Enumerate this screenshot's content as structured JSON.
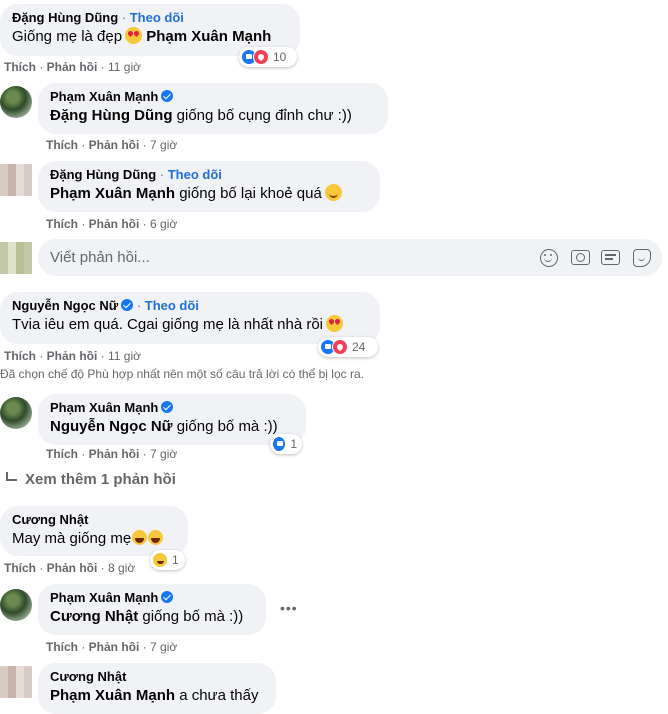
{
  "actions": {
    "like": "Thích",
    "reply": "Phản hồi"
  },
  "comments": [
    {
      "author": "Đặng Hùng Dũng",
      "follow": "Theo dõi",
      "text": "Giống mẹ là đẹp",
      "mention": "Phạm Xuân Mạnh",
      "time": "11 giờ",
      "reactions": "10"
    },
    {
      "author": "Phạm Xuân Mạnh",
      "mention": "Đặng Hùng Dũng",
      "text": "giống bố cụng đỉnh chư :))",
      "time": "7 giờ"
    },
    {
      "author": "Đặng Hùng Dũng",
      "follow": "Theo dõi",
      "mention": "Phạm Xuân Mạnh",
      "text": "giống bố lại khoẻ quá",
      "time": "6 giờ"
    },
    {
      "author": "Nguyễn Ngọc Nữ",
      "follow": "Theo dõi",
      "text": "Tvia iêu em quá. Cgai giống mẹ là nhất nhà rồi",
      "time": "11 giờ",
      "reactions": "24"
    },
    {
      "author": "Phạm Xuân Mạnh",
      "mention": "Nguyễn Ngọc Nữ",
      "text": "giống bố mà :))",
      "time": "7 giờ",
      "reactions": "1"
    },
    {
      "author": "Cương Nhật",
      "text": "May mà giống mẹ",
      "time": "8 giờ",
      "reactions": "1"
    },
    {
      "author": "Phạm Xuân Mạnh",
      "mention": "Cương Nhật",
      "text": "giống bố mà :))",
      "time": "7 giờ",
      "more": "•••"
    },
    {
      "author": "Cương Nhật",
      "mention": "Phạm Xuân Mạnh",
      "text": "a chưa thấy"
    }
  ],
  "reply_box": {
    "placeholder": "Viết phản hồi..."
  },
  "filter_notice": "Đã chọn chế độ Phù hợp nhất nên một số câu trả lời có thể bị lọc ra.",
  "see_more": "Xem thêm 1 phản hồi",
  "separator": " · ",
  "icons": [
    "emoji-icon",
    "camera-icon",
    "gif-icon",
    "sticker-icon",
    "verified-icon",
    "reply-arrow-icon"
  ],
  "colors": {
    "bubble": "#f0f2f5",
    "link": "#216fdb",
    "verified": "#1877f2",
    "meta": "#65676b"
  }
}
